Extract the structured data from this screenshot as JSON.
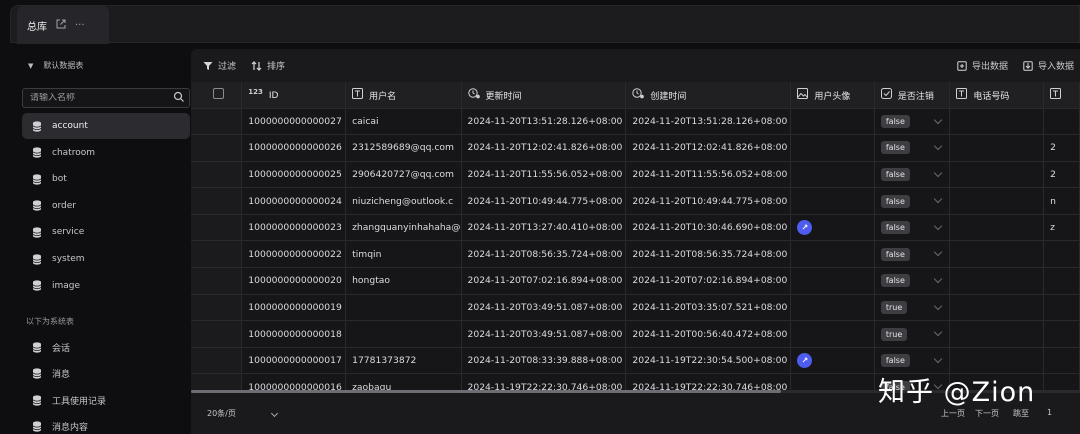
{
  "tab": {
    "title": "总库",
    "open_icon": "external-link-icon",
    "more_icon": "more-icon"
  },
  "sidebar": {
    "db_name": "默认数据表",
    "search_placeholder": "请输入名称",
    "tables": [
      {
        "label": "account",
        "active": true
      },
      {
        "label": "chatroom"
      },
      {
        "label": "bot"
      },
      {
        "label": "order"
      },
      {
        "label": "service"
      },
      {
        "label": "system"
      },
      {
        "label": "image"
      }
    ],
    "system_label": "以下为系统表",
    "system_tables": [
      {
        "label": "会话"
      },
      {
        "label": "消息"
      },
      {
        "label": "工具使用记录"
      },
      {
        "label": "消息内容"
      }
    ]
  },
  "toolbar": {
    "filter": "过滤",
    "sort": "排序",
    "export": "导出数据",
    "import": "导入数据"
  },
  "columns": [
    {
      "label": "",
      "icon": ""
    },
    {
      "label": "ID",
      "icon": "123"
    },
    {
      "label": "用户名",
      "icon": "text-field-icon"
    },
    {
      "label": "更新时间",
      "icon": "clock-user-icon"
    },
    {
      "label": "创建时间",
      "icon": "clock-user-icon"
    },
    {
      "label": "用户头像",
      "icon": "image-icon"
    },
    {
      "label": "是否注销",
      "icon": "checkbox-icon"
    },
    {
      "label": "电话号码",
      "icon": "text-field-icon"
    },
    {
      "label": "",
      "icon": "text-field-icon"
    }
  ],
  "rows": [
    {
      "id": "1000000000000027",
      "username": "caicai",
      "updated": "2024-11-20T13:51:28.126+08:00",
      "created": "2024-11-20T13:51:28.126+08:00",
      "avatar": false,
      "deleted": "false",
      "phone": "",
      "extra": ""
    },
    {
      "id": "1000000000000026",
      "username": "2312589689@qq.com",
      "updated": "2024-11-20T12:02:41.826+08:00",
      "created": "2024-11-20T12:02:41.826+08:00",
      "avatar": false,
      "deleted": "false",
      "phone": "",
      "extra": "2"
    },
    {
      "id": "1000000000000025",
      "username": "2906420727@qq.com",
      "updated": "2024-11-20T11:55:56.052+08:00",
      "created": "2024-11-20T11:55:56.052+08:00",
      "avatar": false,
      "deleted": "false",
      "phone": "",
      "extra": "2"
    },
    {
      "id": "1000000000000024",
      "username": "niuzicheng@outlook.c",
      "updated": "2024-11-20T10:49:44.775+08:00",
      "created": "2024-11-20T10:49:44.775+08:00",
      "avatar": false,
      "deleted": "false",
      "phone": "",
      "extra": "n"
    },
    {
      "id": "1000000000000023",
      "username": "zhangquanyinhahaha@",
      "updated": "2024-11-20T13:27:40.410+08:00",
      "created": "2024-11-20T10:30:46.690+08:00",
      "avatar": true,
      "deleted": "false",
      "phone": "",
      "extra": "z"
    },
    {
      "id": "1000000000000022",
      "username": "timqin",
      "updated": "2024-11-20T08:56:35.724+08:00",
      "created": "2024-11-20T08:56:35.724+08:00",
      "avatar": false,
      "deleted": "false",
      "phone": "",
      "extra": ""
    },
    {
      "id": "1000000000000020",
      "username": "hongtao",
      "updated": "2024-11-20T07:02:16.894+08:00",
      "created": "2024-11-20T07:02:16.894+08:00",
      "avatar": false,
      "deleted": "false",
      "phone": "",
      "extra": ""
    },
    {
      "id": "1000000000000019",
      "username": "",
      "updated": "2024-11-20T03:49:51.087+08:00",
      "created": "2024-11-20T03:35:07.521+08:00",
      "avatar": false,
      "deleted": "true",
      "phone": "",
      "extra": ""
    },
    {
      "id": "1000000000000018",
      "username": "",
      "updated": "2024-11-20T03:49:51.087+08:00",
      "created": "2024-11-20T00:56:40.472+08:00",
      "avatar": false,
      "deleted": "true",
      "phone": "",
      "extra": ""
    },
    {
      "id": "1000000000000017",
      "username": "17781373872",
      "updated": "2024-11-20T08:33:39.888+08:00",
      "created": "2024-11-19T22:30:54.500+08:00",
      "avatar": true,
      "deleted": "false",
      "phone": "",
      "extra": ""
    },
    {
      "id": "1000000000000016",
      "username": "zaobagu",
      "updated": "2024-11-19T22:22:30.746+08:00",
      "created": "2024-11-19T22:22:30.746+08:00",
      "avatar": false,
      "deleted": "false",
      "phone": "",
      "extra": ""
    }
  ],
  "footer": {
    "page_size": "20条/页",
    "prev": "上一页",
    "next": "下一页",
    "goto": "跳至",
    "page": "1"
  },
  "watermark": "知乎 @Zion"
}
